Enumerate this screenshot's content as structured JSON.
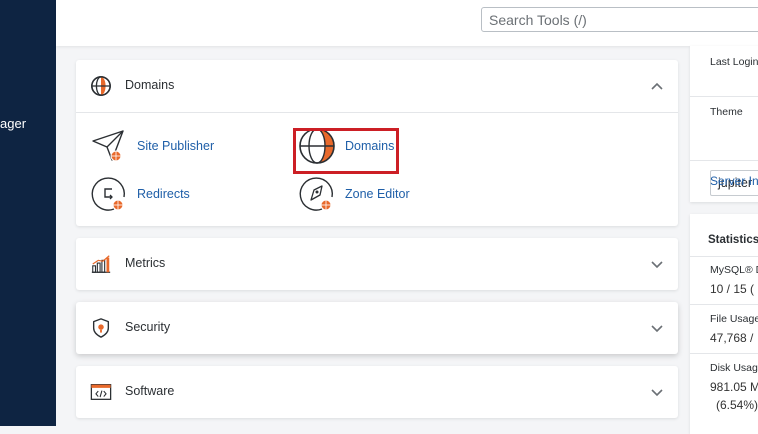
{
  "left_nav": {
    "label": "ager"
  },
  "header": {
    "search_placeholder": "Search Tools (/)"
  },
  "sections": {
    "domains": {
      "title": "Domains",
      "tools": [
        {
          "label": "Site Publisher",
          "icon": "paper-plane-globe-icon"
        },
        {
          "label": "Domains",
          "icon": "globe-icon"
        },
        {
          "label": "Redirects",
          "icon": "redirect-arrow-globe-icon"
        },
        {
          "label": "Zone Editor",
          "icon": "rocket-globe-icon"
        }
      ]
    },
    "metrics": {
      "title": "Metrics"
    },
    "security": {
      "title": "Security"
    },
    "software": {
      "title": "Software"
    }
  },
  "right_panel": {
    "last_login_label": "Last Login",
    "theme_label": "Theme",
    "theme_value": "jupiter",
    "server_info_link": "Server In",
    "statistics_title": "Statistics",
    "mysql_label": "MySQL® D",
    "mysql_value": "10 / 15   (",
    "file_usage_label": "File Usage",
    "file_usage_value": "47,768 /",
    "disk_usage_label": "Disk Usag",
    "disk_usage_value": "981.05 M",
    "disk_usage_pct": "(6.54%)"
  },
  "colors": {
    "nav_bg": "#0e2442",
    "accent_orange": "#e8692b",
    "highlight_red": "#cc1f25",
    "link_blue": "#1f5fa8"
  }
}
